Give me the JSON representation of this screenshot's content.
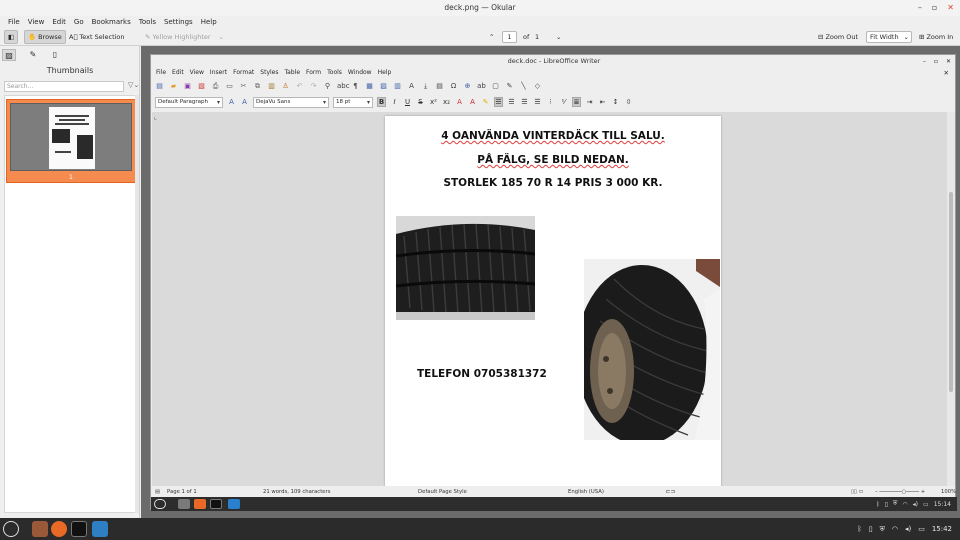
{
  "window": {
    "title": "deck.png — Okular"
  },
  "menubar": [
    "File",
    "View",
    "Edit",
    "Go",
    "Bookmarks",
    "Tools",
    "Settings",
    "Help"
  ],
  "toolbar": {
    "browse": "Browse",
    "text_selection": "Text Selection",
    "highlighter": "Yellow Highlighter",
    "page_current": "1",
    "page_of": "of",
    "page_total": "1",
    "zoom_out": "Zoom Out",
    "zoom_mode": "Fit Width",
    "zoom_in": "Zoom In"
  },
  "sidebar": {
    "title": "Thumbnails",
    "search_placeholder": "Search...",
    "thumb_page": "1"
  },
  "writer": {
    "title": "deck.doc - LibreOffice Writer",
    "menu": [
      "File",
      "Edit",
      "View",
      "Insert",
      "Format",
      "Styles",
      "Table",
      "Form",
      "Tools",
      "Window",
      "Help"
    ],
    "para_style": "Default Paragraph",
    "font_name": "DejaVu Sans",
    "font_size": "18 pt",
    "doc": {
      "line1": "4 OANVÄNDA VINTERDÄCK TILL SALU.",
      "line2": "PÅ FÄLG, SE BILD NEDAN.",
      "line3": "STORLEK 185 70 R 14 PRIS 3 000 KR.",
      "phone": "TELEFON 0705381372"
    },
    "status": {
      "page": "Page 1 of 1",
      "words": "21 words, 109 characters",
      "page_style": "Default Page Style",
      "language": "English (USA)",
      "zoom": "100%"
    },
    "tray_time": "15:14"
  },
  "taskbar": {
    "time": "15:42"
  },
  "colors": {
    "accent": "#f58b4f",
    "taskbar": "#2b2b2b"
  }
}
